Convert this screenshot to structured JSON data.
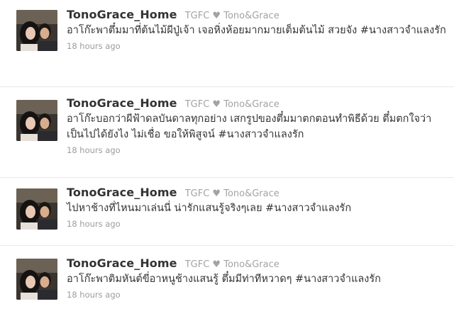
{
  "tweets": [
    {
      "screen_name": "TonoGrace_Home",
      "full_name": "TGFC ♥ Tono&Grace",
      "text": "อาโก๊ะพาตึ๋มมาที่ต้นไม้ผีปู่เจ้า เจอหิ่งห้อยมากมายเต็มต้นไม้ สวยจัง #นางสาวจำแลงรัก",
      "time": "18 hours ago"
    },
    {
      "screen_name": "TonoGrace_Home",
      "full_name": "TGFC ♥ Tono&Grace",
      "text": "อาโก๊ะบอกว่าผีฟ้าดลบันดาลทุกอย่าง เสกรูปของตึ๋มมาตกตอนทำพิธีด้วย ตึ๋มตกใจว่าเป็นไปได้ยังไง ไม่เชื่อ ขอให้พิสูจน์ #นางสาวจำแลงรัก",
      "time": "18 hours ago"
    },
    {
      "screen_name": "TonoGrace_Home",
      "full_name": "TGFC ♥ Tono&Grace",
      "text": "ไปหาช้างที่ไหนมาเล่นนี่ น่ารักแสนรู้จริงๆเลย #นางสาวจำแลงรัก",
      "time": "18 hours ago"
    },
    {
      "screen_name": "TonoGrace_Home",
      "full_name": "TGFC ♥ Tono&Grace",
      "text": "อาโก๊ะพาติมหันต์ขี่อาหนูช้างแสนรู้ ตึ๋มมีท่าทีหวาดๆ #นางสาวจำแลงรัก",
      "time": "18 hours ago"
    }
  ]
}
